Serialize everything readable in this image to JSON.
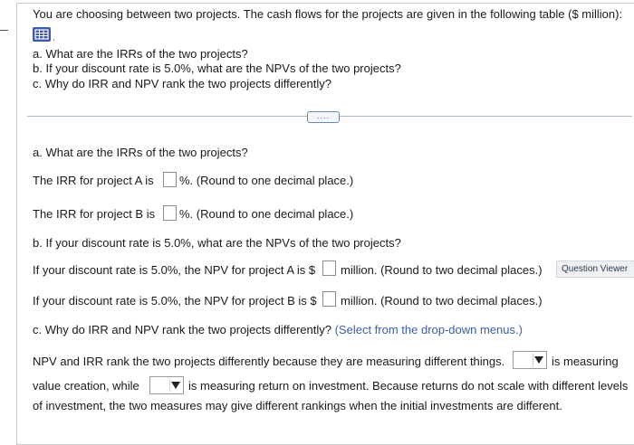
{
  "header": {
    "intro": "You are choosing between two projects. The cash flows for the projects are given in the following table ($ million):",
    "q_a": "a. What are the IRRs of the two projects?",
    "q_b": "b. If your discount rate is 5.0%, what are the NPVs of the two projects?",
    "q_c": "c. Why do IRR and NPV rank the two projects differently?"
  },
  "more_button": "....",
  "part_a": {
    "heading": "a. What are the IRRs of the two projects?",
    "irr_a_prefix": "The IRR for project A is",
    "irr_a_suffix": "%.  (Round to one decimal place.)",
    "irr_b_prefix": "The IRR for project B is",
    "irr_b_suffix": "%.  (Round to one decimal place.)",
    "irr_a_value": "",
    "irr_b_value": ""
  },
  "part_b": {
    "heading": "b. If your discount rate is 5.0%, what are the NPVs of the two projects?",
    "npv_a_prefix": "If your discount rate is 5.0%, the NPV for project A is $",
    "npv_a_suffix": "million.  (Round to two decimal places.)",
    "npv_b_prefix": "If your discount rate is 5.0%, the NPV for project B is $",
    "npv_b_suffix": "million.  (Round to two decimal places.)"
  },
  "part_c": {
    "heading": "c. Why do IRR and NPV rank the two projects differently?",
    "hint": "(Select from the drop-down menus.)",
    "line1_pre": "NPV and IRR rank the two projects differently because they are measuring different things.",
    "line1_post": "is measuring",
    "line2_pre": "value creation, while",
    "line2_post": "is measuring return on investment. Because returns do not scale with different levels",
    "line3": "of investment, the two measures may give different rankings when the initial investments are different."
  },
  "question_viewer": "Question Viewer",
  "colors": {
    "link_blue": "#3a5ea8",
    "icon_blue": "#3d5aa6"
  }
}
